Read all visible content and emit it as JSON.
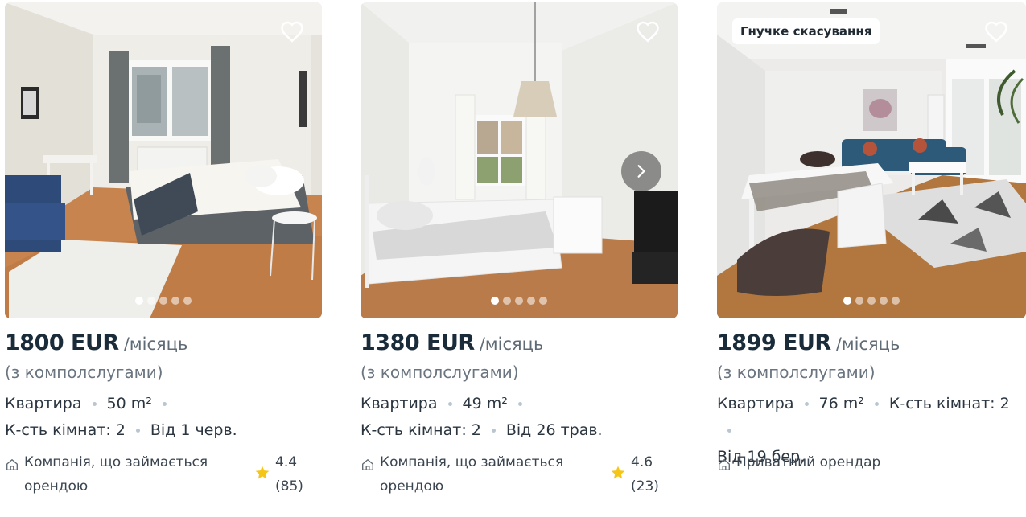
{
  "listings": [
    {
      "price": "1800 EUR",
      "period": "/місяць",
      "utilities": "(з комполслугами)",
      "type": "Квартира",
      "area": "50 m²",
      "rooms": "К-сть кімнат: 2",
      "available": "Від 1 черв.",
      "landlord": "Компанія, що займається орендою",
      "rating": "4.4",
      "reviews": "(85)",
      "photo_dots": 5
    },
    {
      "price": "1380 EUR",
      "period": "/місяць",
      "utilities": "(з комполслугами)",
      "type": "Квартира",
      "area": "49 m²",
      "rooms": "К-сть кімнат: 2",
      "available": "Від 26 трав.",
      "landlord": "Компанія, що займається орендою",
      "rating": "4.6",
      "reviews": "(23)",
      "photo_dots": 5
    },
    {
      "badge": "Гнучке скасування",
      "price": "1899 EUR",
      "period": "/місяць",
      "utilities": "(з комполслугами)",
      "type": "Квартира",
      "area": "76 m²",
      "rooms": "К-сть кімнат: 2",
      "available": "Від 19 бер.",
      "landlord": "Приватний орендар",
      "photo_dots": 5
    }
  ],
  "icons": {
    "favorite": "heart-outline-icon",
    "next": "chevron-right-icon",
    "landlord": "house-icon",
    "rating": "star-icon"
  },
  "colors": {
    "star": "#f5c518",
    "price": "#1a2b3a",
    "muted": "#6a7580"
  }
}
